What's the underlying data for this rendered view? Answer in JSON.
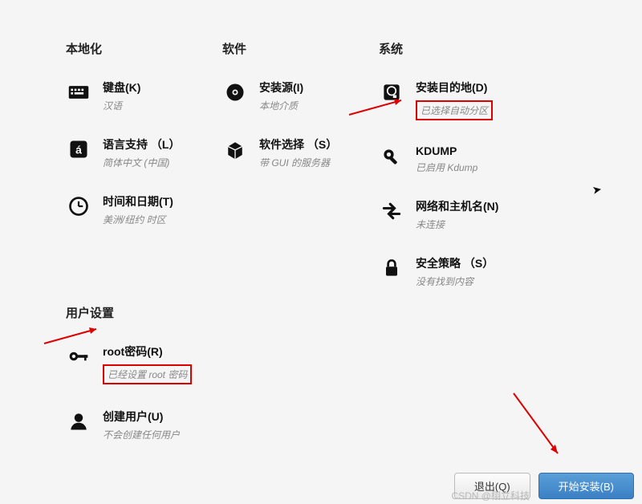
{
  "sections": {
    "localization": {
      "title": "本地化"
    },
    "software": {
      "title": "软件"
    },
    "system": {
      "title": "系统"
    },
    "user": {
      "title": "用户设置"
    }
  },
  "spokes": {
    "keyboard": {
      "title": "键盘(K)",
      "status": "汉语"
    },
    "language": {
      "title": "语言支持 （L）",
      "status": "简体中文 (中国)"
    },
    "datetime": {
      "title": "时间和日期(T)",
      "status": "美洲/纽约 时区"
    },
    "source": {
      "title": "安装源(I)",
      "status": "本地介质"
    },
    "software_sel": {
      "title": "软件选择 （S）",
      "status": "带 GUI 的服务器"
    },
    "destination": {
      "title": "安装目的地(D)",
      "status": "已选择自动分区"
    },
    "kdump": {
      "title": "KDUMP",
      "status": "已启用 Kdump"
    },
    "network": {
      "title": "网络和主机名(N)",
      "status": "未连接"
    },
    "security": {
      "title": "安全策略 （S）",
      "status": "没有找到内容"
    },
    "rootpw": {
      "title": "root密码(R)",
      "status": "已经设置 root 密码"
    },
    "user_create": {
      "title": "创建用户(U)",
      "status": "不会创建任何用户"
    }
  },
  "buttons": {
    "quit": "退出(Q)",
    "begin": "开始安装(B)"
  },
  "watermark": "CSDN @栩立科技"
}
